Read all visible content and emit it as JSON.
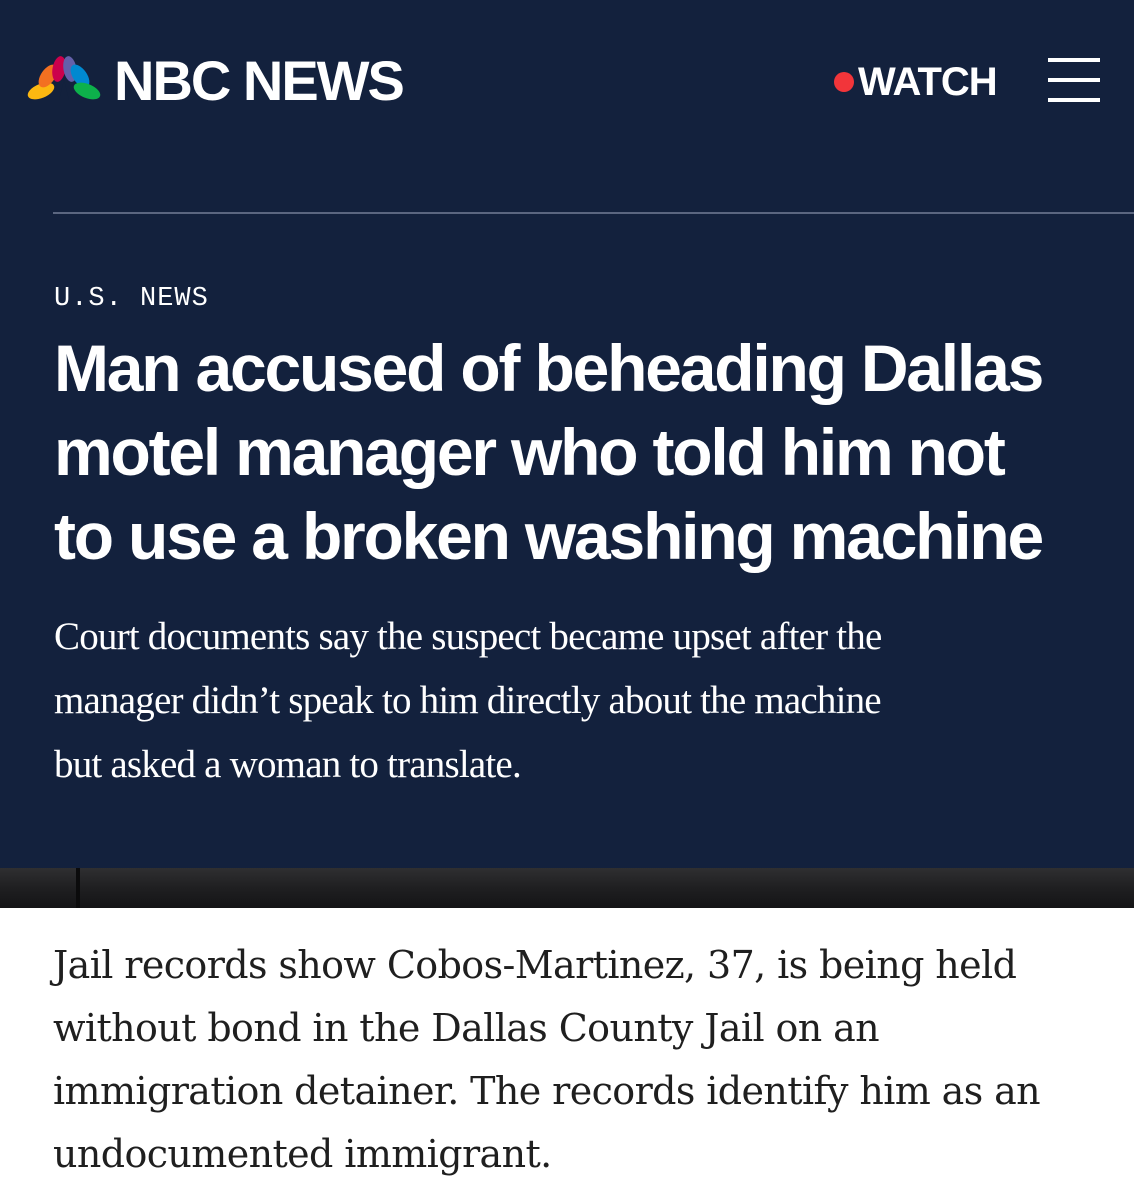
{
  "header": {
    "brand": "NBC NEWS",
    "watch_label": "WATCH",
    "colors": {
      "background": "#13213d",
      "live_dot": "#f2353a",
      "peacock": [
        "#fcb711",
        "#f37021",
        "#cc004c",
        "#6460aa",
        "#0089d0",
        "#0db14b"
      ]
    },
    "icons": [
      "nbc-peacock-logo",
      "live-dot-icon",
      "hamburger-menu-icon"
    ]
  },
  "article": {
    "section": "U.S. NEWS",
    "headline_lines": [
      "Man accused of beheading Dallas",
      "motel manager who told him not",
      "to use a broken washing machine"
    ],
    "dek_lines": [
      "Court documents say the suspect became upset after the",
      "manager didn’t speak to him directly about the machine",
      "but asked a woman to translate."
    ],
    "body_lines": [
      "Jail records show Cobos-Martinez, 37, is being held",
      "without bond in the Dallas County Jail on an",
      "immigration detainer. The records identify him as an",
      "undocumented immigrant."
    ]
  }
}
